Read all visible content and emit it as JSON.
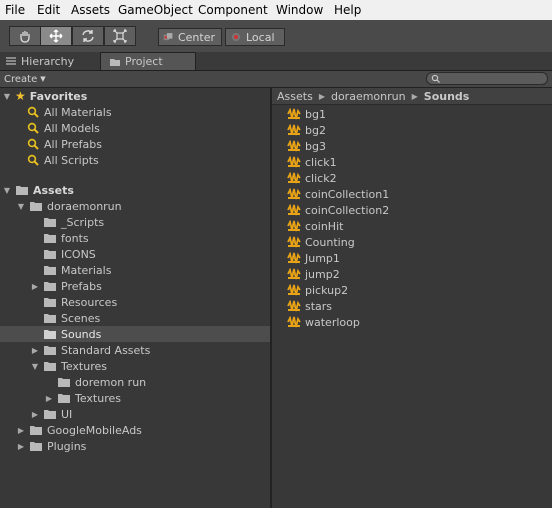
{
  "menu": [
    "File",
    "Edit",
    "Assets",
    "GameObject",
    "Component",
    "Window",
    "Help"
  ],
  "toolbar": {
    "tools": [
      "hand-tool",
      "move-tool",
      "rotate-tool",
      "scale-tool"
    ],
    "active_tool": "move-tool",
    "pivot_label": "Center",
    "space_label": "Local"
  },
  "tabs": {
    "hierarchy": "Hierarchy",
    "project": "Project"
  },
  "project_header": {
    "create_label": "Create"
  },
  "favorites": {
    "title": "Favorites",
    "items": [
      "All Materials",
      "All Models",
      "All Prefabs",
      "All Scripts"
    ]
  },
  "assets_tree": {
    "title": "Assets",
    "root": "doraemonrun",
    "children": [
      "_Scripts",
      "fonts",
      "ICONS",
      "Materials",
      "Prefabs",
      "Resources",
      "Scenes",
      "Sounds",
      "Standard Assets",
      "Textures"
    ],
    "textures_children": [
      "doremon run",
      "Textures"
    ],
    "ui": "UI",
    "top_level": [
      "GoogleMobileAds",
      "Plugins"
    ],
    "selected": "Sounds"
  },
  "breadcrumb": [
    "Assets",
    "doraemonrun",
    "Sounds"
  ],
  "sound_files": [
    "bg1",
    "bg2",
    "bg3",
    "click1",
    "click2",
    "coinCollection1",
    "coinCollection2",
    "coinHit",
    "Counting",
    "Jump1",
    "jump2",
    "pickup2",
    "stars",
    "waterloop"
  ],
  "colors": {
    "audio_icon": "#e8a317",
    "folder_icon": "#b9b9b9",
    "favorite_star": "#f2c230"
  }
}
